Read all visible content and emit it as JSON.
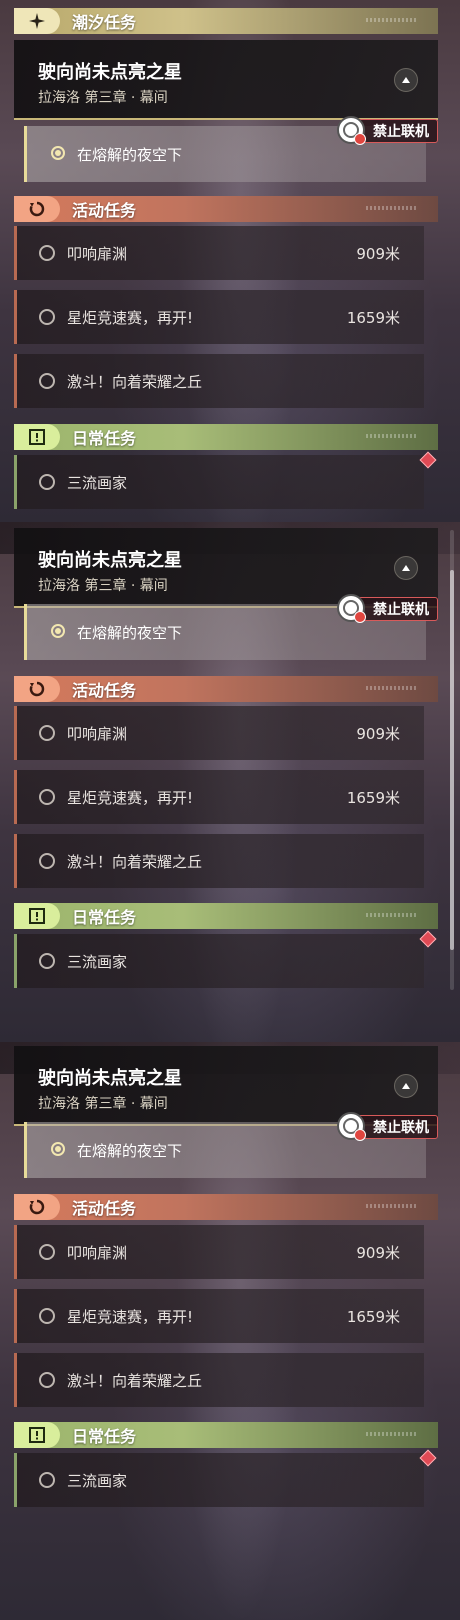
{
  "categories": {
    "tide": "潮汐任务",
    "event": "活动任务",
    "daily": "日常任务"
  },
  "main_quest": {
    "title": "驶向尚未点亮之星",
    "chapter": "拉海洛 第三章 · 幕间",
    "objective": "在熔解的夜空下",
    "restriction": "禁止联机"
  },
  "event_quests": [
    {
      "label": "叩响扉渊",
      "distance": "909米"
    },
    {
      "label": "星炬竞速赛，再开!",
      "distance": "1659米"
    },
    {
      "label": "激斗！向着荣耀之丘",
      "distance": ""
    }
  ],
  "daily_quests": [
    {
      "label": "三流画家"
    }
  ],
  "colors": {
    "tide_accent": "#efe6b8",
    "event_accent": "#f2a484",
    "daily_accent": "#d9ee9c",
    "restriction_border": "#d85a5a"
  },
  "icons": {
    "tide": "sparkle-icon",
    "event": "refresh-icon",
    "daily": "exclamation-icon",
    "collapse": "chevron-up-icon",
    "restriction": "no-multiplayer-icon",
    "marker": "red-diamond-icon"
  }
}
